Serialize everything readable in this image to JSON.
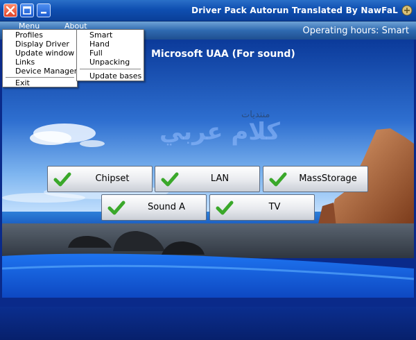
{
  "window": {
    "title": "Driver Pack Autorun Translated By NawFaL",
    "close_icon": "close-icon",
    "maximize_icon": "maximize-icon",
    "minimize_icon": "minimize-icon",
    "app_icon": "app-icon"
  },
  "menubar": {
    "menu_label": "Menu",
    "about_label": "About",
    "operating_hours": "Operating hours: Smart"
  },
  "menu_dropdown": {
    "items": [
      "Profiles",
      "Display Driver",
      "Update window",
      "Links",
      "Device Manager"
    ],
    "exit": "Exit"
  },
  "profiles_submenu": {
    "items": [
      "Smart",
      "Hand",
      "Full",
      "Unpacking"
    ],
    "update": "Update bases"
  },
  "main": {
    "heading": "Microsoft UAA (For sound)",
    "watermark": "كلام عربي",
    "watermark_small": "منتديات"
  },
  "drivers": [
    {
      "label": "Chipset",
      "checked": true
    },
    {
      "label": "LAN",
      "checked": true
    },
    {
      "label": "MassStorage",
      "checked": true
    },
    {
      "label": "Sound A",
      "checked": true
    },
    {
      "label": "TV",
      "checked": true
    }
  ],
  "colors": {
    "titlebar": "#0f4fb1",
    "check_green": "#3aa82a"
  }
}
